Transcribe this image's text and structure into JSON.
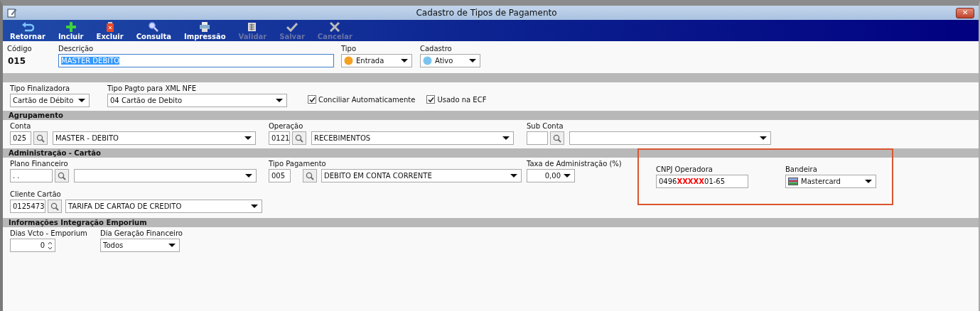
{
  "window": {
    "title": "Cadastro de Tipos de Pagamento",
    "close": "✕"
  },
  "toolbar": [
    {
      "label": "Retornar",
      "kind": "return",
      "disabled": false
    },
    {
      "label": "Incluir",
      "kind": "add",
      "disabled": false
    },
    {
      "label": "Excluir",
      "kind": "delete",
      "disabled": false
    },
    {
      "label": "Consulta",
      "kind": "search",
      "disabled": false
    },
    {
      "label": "Impressão",
      "kind": "print",
      "disabled": false
    },
    {
      "label": "Validar",
      "kind": "validate",
      "disabled": true
    },
    {
      "label": "Salvar",
      "kind": "save",
      "disabled": true
    },
    {
      "label": "Cancelar",
      "kind": "cancel",
      "disabled": true
    }
  ],
  "header": {
    "codigo": {
      "label": "Código",
      "value": "015"
    },
    "descricao": {
      "label": "Descrição",
      "value": "MASTER DEBITO",
      "selected": true
    },
    "tipo": {
      "label": "Tipo",
      "value": "Entrada"
    },
    "cadastro": {
      "label": "Cadastro",
      "value": "Ativo"
    }
  },
  "general": {
    "tipo_finalizadora": {
      "label": "Tipo Finalizadora",
      "value": "Cartão de Débito"
    },
    "tipo_pagto_xml": {
      "label": "Tipo Pagto para XML NFE",
      "value": "04 Cartão de Debito"
    },
    "checkboxes": [
      {
        "label": "Conciliar Automaticamente",
        "checked": true
      },
      {
        "label": "Usado na ECF",
        "checked": true
      }
    ]
  },
  "agrupamento": {
    "title": "Agrupamento",
    "conta": {
      "label": "Conta",
      "code": "025",
      "name": "MASTER - DEBITO"
    },
    "operacao": {
      "label": "Operação",
      "code": "0121",
      "name": "RECEBIMENTOS"
    },
    "sub_conta": {
      "label": "Sub Conta"
    }
  },
  "administracao": {
    "title": "Administração - Cartão",
    "plano_financeiro": {
      "label": "Plano Financeiro",
      "code": ".  ."
    },
    "tipo_pagamento": {
      "label": "Tipo Pagamento",
      "code": "005",
      "name": "DEBITO EM CONTA CORRENTE"
    },
    "taxa": {
      "label": "Taxa de Administração (%)",
      "value": "0,00"
    },
    "cnpj": {
      "label": "CNPJ Operadora",
      "value_start": "0496",
      "redaction": "XXXXX",
      "value_end": "01-65"
    },
    "bandeira": {
      "label": "Bandeira",
      "value": "Mastercard"
    },
    "cliente_cartao": {
      "label": "Cliente Cartão",
      "code": "0125473",
      "name": "TARIFA DE CARTAO DE CREDITO"
    }
  },
  "emporium": {
    "title": "Informações Integração Emporium",
    "dias_vcto": {
      "label": "Dias Vcto - Emporium",
      "value": "0"
    },
    "dia_geracao": {
      "label": "Dia Geração Financeiro",
      "value": "Todos"
    }
  }
}
